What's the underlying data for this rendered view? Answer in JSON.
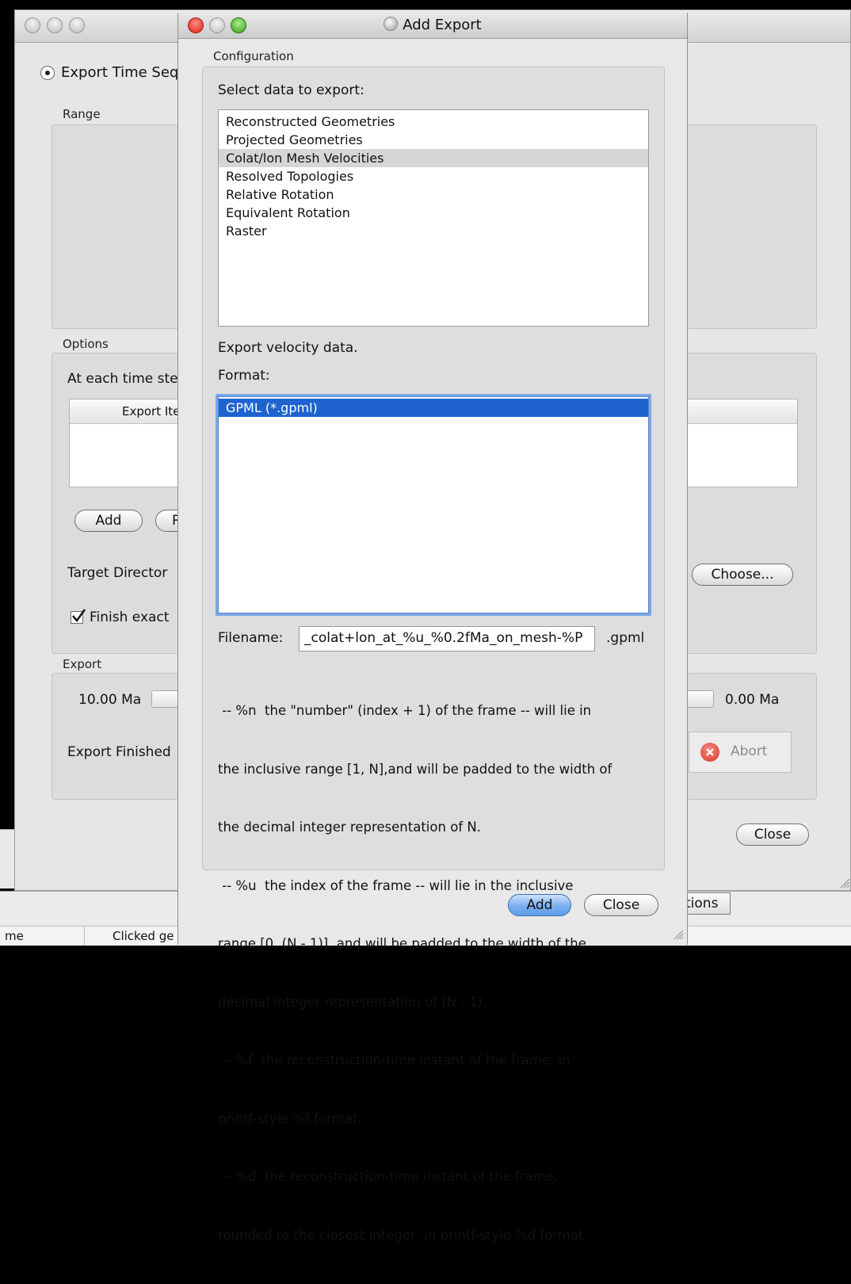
{
  "background_window": {
    "radio_label": "Export Time Seq",
    "range_label": "Range",
    "options_label": "Options",
    "at_each_time_step": "At each time ste",
    "export_items_header": "Export Ite",
    "add_button": "Add",
    "remove_button_partial": "R",
    "target_directory": "Target Director",
    "choose_button": "Choose...",
    "finish_exactly": "Finish exact",
    "export_label": "Export",
    "start_time": "10.00 Ma",
    "end_time": "0.00 Ma",
    "export_finished": "Export Finished",
    "abort_button": "Abort",
    "close_button": "Close",
    "tions_button_partial": "tions",
    "status_left": "me",
    "status_clicked": "Clicked ge"
  },
  "dialog": {
    "title": "Add Export",
    "configuration_label": "Configuration",
    "select_data_label": "Select data to export:",
    "data_items": [
      "Reconstructed Geometries",
      "Projected Geometries",
      "Colat/lon Mesh Velocities",
      "Resolved Topologies",
      "Relative Rotation",
      "Equivalent Rotation",
      "Raster"
    ],
    "selected_data_index": 2,
    "description": "Export velocity data.",
    "format_label": "Format:",
    "formats": [
      "GPML (*.gpml)"
    ],
    "filename_label": "Filename:",
    "filename_value": "_colat+lon_at_%u_%0.2fMa_on_mesh-%P",
    "filename_ext": ".gpml",
    "help_lines": [
      " -- %n  the \"number\" (index + 1) of the frame -- will lie in",
      "the inclusive range [1, N],and will be padded to the width of",
      "the decimal integer representation of N.",
      " -- %u  the index of the frame -- will lie in the inclusive",
      "range [0, (N - 1)], and will be padded to the width of the",
      "decimal integer representation of (N - 1).",
      " -- %f  the reconstruction-time instant of the frame, in",
      "printf-style %f format.",
      " -- %d  the reconstruction-time instant of the frame,",
      "rounded to the closest integer, in printf-style %d format."
    ],
    "add_button": "Add",
    "close_button": "Close"
  },
  "colors": {
    "selection_blue": "#1e63cf",
    "focus_ring": "#7aa7e8",
    "abort_red": "#d9382c"
  }
}
